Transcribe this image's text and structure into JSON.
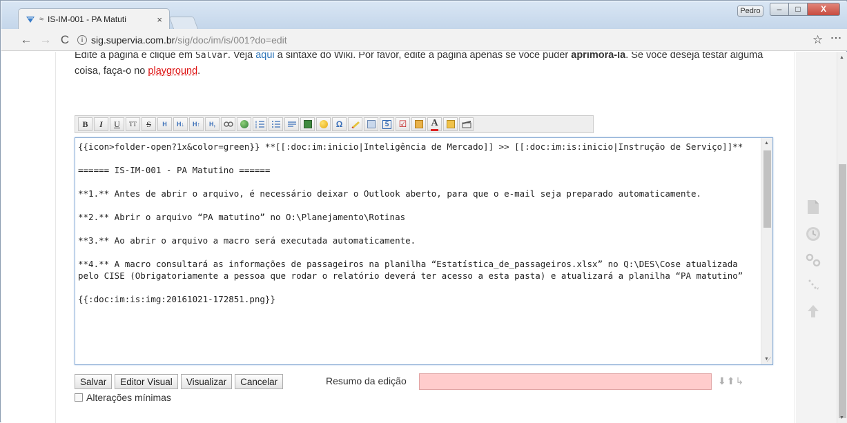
{
  "browser": {
    "tab_title": "IS-IM-001 - PA Matuti",
    "tab_close": "×",
    "user_badge": "Pedro",
    "url_host": "sig.supervia.com.br",
    "url_path": "/sig/doc/im/is/001?do=edit",
    "window_controls": [
      "–",
      "□",
      "X"
    ]
  },
  "intro": {
    "part1": "Edite a página e clique em ",
    "save_word": "Salvar",
    "part2": ". Veja ",
    "aqui": "aqui",
    "part3": " a sintaxe do Wiki. Por favor, edite a página apenas se você puder ",
    "aprimora": "aprimorá-la",
    "part4": ". Se você deseja testar alguma coisa, faça-o no ",
    "playground": "playground",
    "part5": "."
  },
  "toolbar": {
    "bold": "B",
    "italic": "I",
    "underline": "U",
    "code": "TT",
    "strike": "S"
  },
  "editor": {
    "text": "{{icon>folder-open?1x&color=green}} **[[:doc:im:inicio|Inteligência de Mercado]] >> [[:doc:im:is:inicio|Instrução de Serviço]]**\n\n====== IS-IM-001 - PA Matutino ======\n\n**1.** Antes de abrir o arquivo, é necessário deixar o Outlook aberto, para que o e-mail seja preparado automaticamente.\n\n**2.** Abrir o arquivo “PA matutino” no O:\\Planejamento\\Rotinas\n\n**3.** Ao abrir o arquivo a macro será executada automaticamente.\n\n**4.** A macro consultará as informações de passageiros na planilha “Estatística_de_passageiros.xlsx” no Q:\\DES\\Cose atualizada pelo CISE (Obrigatoriamente a pessoa que rodar o relatório deverá ter acesso a esta pasta) e atualizará a planilha “PA matutino”\n\n{{:doc:im:is:img:20161021-172851.png}}"
  },
  "buttons": {
    "save": "Salvar",
    "visual_editor": "Editor Visual",
    "preview": "Visualizar",
    "cancel": "Cancelar"
  },
  "summary": {
    "label": "Resumo da edição",
    "value": ""
  },
  "minor_changes": {
    "label": "Alterações mínimas",
    "checked": false
  },
  "colors": {
    "summary_bg": "#ffcccc",
    "link_blue": "#2b73b7",
    "link_red": "#dd1111",
    "editor_border": "#8fb0d7"
  }
}
